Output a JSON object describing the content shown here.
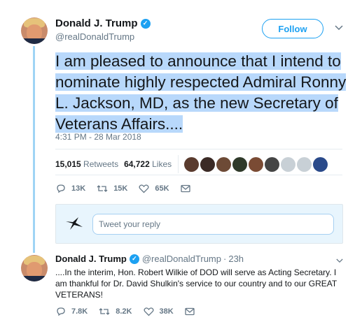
{
  "colors": {
    "accent": "#1da1f2",
    "highlight": "#b8d8fb",
    "thread_line": "#9fd4f5",
    "muted": "#657786"
  },
  "main_tweet": {
    "display_name": "Donald J. Trump",
    "verified_icon": "verified-badge-icon",
    "handle": "@realDonaldTrump",
    "follow_label": "Follow",
    "text": "I am pleased to announce that I intend to nominate highly respected Admiral Ronny L. Jackson, MD, as the new Secretary of Veterans Affairs....",
    "timestamp": "4:31 PM - 28 Mar 2018",
    "retweets_count": "15,015",
    "retweets_label": "Retweets",
    "likes_count": "64,722",
    "likes_label": "Likes",
    "actions": {
      "reply": "13K",
      "retweet": "15K",
      "like": "65K"
    }
  },
  "reply_box": {
    "placeholder": "Tweet your reply"
  },
  "reply_tweet": {
    "display_name": "Donald J. Trump",
    "handle": "@realDonaldTrump",
    "separator": "·",
    "time": "23h",
    "text": "....In the interim, Hon. Robert Wilkie of DOD will serve as Acting Secretary. I am thankful for Dr. David Shulkin's service to our country and to our GREAT VETERANS!",
    "actions": {
      "reply": "7.8K",
      "retweet": "8.2K",
      "like": "38K"
    }
  }
}
